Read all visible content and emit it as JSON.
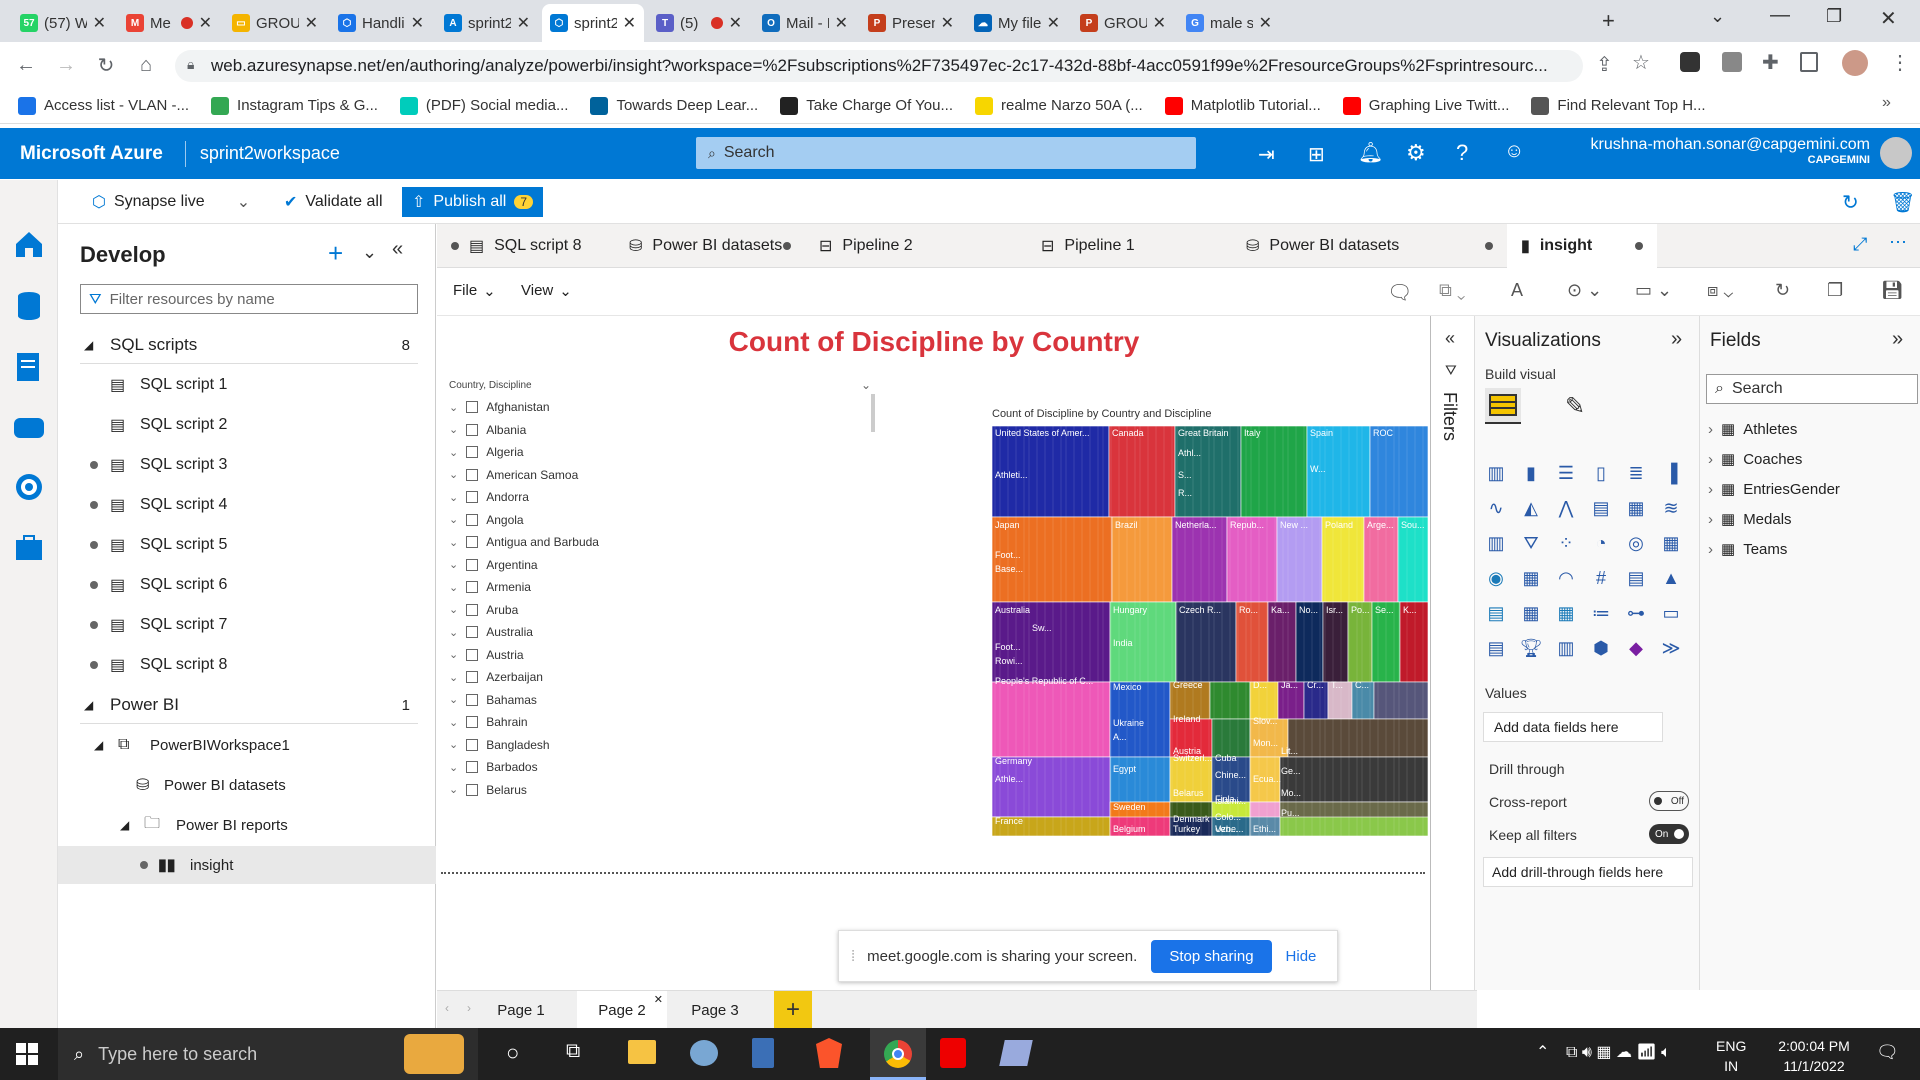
{
  "browser": {
    "tabs": [
      {
        "label": "(57) Wh",
        "color": "#25d366",
        "glyph": "57"
      },
      {
        "label": "Me",
        "color": "#ea4335",
        "glyph": "M",
        "recording": true
      },
      {
        "label": "GROUP",
        "color": "#f4b400",
        "glyph": "▭"
      },
      {
        "label": "Handlin",
        "color": "#1a73e8",
        "glyph": "⬡"
      },
      {
        "label": "sprint2",
        "color": "#0078d4",
        "glyph": "A"
      },
      {
        "label": "sprint2",
        "color": "#0078d4",
        "glyph": "⬡",
        "active": true
      },
      {
        "label": "(5)",
        "color": "#5b5fc7",
        "glyph": "T",
        "recording": true
      },
      {
        "label": "Mail - P",
        "color": "#0f6cbd",
        "glyph": "O"
      },
      {
        "label": "Present",
        "color": "#c43e1c",
        "glyph": "P"
      },
      {
        "label": "My files",
        "color": "#0364b8",
        "glyph": "☁"
      },
      {
        "label": "GROUP",
        "color": "#c43e1c",
        "glyph": "P"
      },
      {
        "label": "male sy",
        "color": "#4285f4",
        "glyph": "G"
      }
    ],
    "url": "web.azuresynapse.net/en/authoring/analyze/powerbi/insight?workspace=%2Fsubscriptions%2F735497ec-2c17-432d-88bf-4acc0591f99e%2FresourceGroups%2Fsprintresourc...",
    "bookmarks": [
      {
        "label": "Access list - VLAN -...",
        "color": "#1a73e8"
      },
      {
        "label": "Instagram Tips & G...",
        "color": "#34a853"
      },
      {
        "label": "(PDF) Social media...",
        "color": "#00ccbb"
      },
      {
        "label": "Towards Deep Lear...",
        "color": "#00629b"
      },
      {
        "label": "Take Charge Of You...",
        "color": "#222222"
      },
      {
        "label": "realme Narzo 50A (...",
        "color": "#f7d600"
      },
      {
        "label": "Matplotlib Tutorial...",
        "color": "#ff0000"
      },
      {
        "label": "Graphing Live Twitt...",
        "color": "#ff0000"
      },
      {
        "label": "Find Relevant Top H...",
        "color": "#555555"
      }
    ]
  },
  "azure": {
    "brand": "Microsoft Azure",
    "workspace": "sprint2workspace",
    "search_placeholder": "Search",
    "user_email": "krushna-mohan.sonar@capgemini.com",
    "user_org": "CAPGEMINI"
  },
  "toolbar": {
    "synapse_live": "Synapse live",
    "validate_all": "Validate all",
    "publish_all": "Publish all",
    "publish_count": "7"
  },
  "develop": {
    "title": "Develop",
    "filter_placeholder": "Filter resources by name",
    "sql_section": "SQL scripts",
    "sql_count": "8",
    "sql_scripts": [
      "SQL script 1",
      "SQL script 2",
      "SQL script 3",
      "SQL script 4",
      "SQL script 5",
      "SQL script 6",
      "SQL script 7",
      "SQL script 8"
    ],
    "powerbi_section": "Power BI",
    "powerbi_count": "1",
    "workspace_node": "PowerBIWorkspace1",
    "datasets_node": "Power BI datasets",
    "reports_node": "Power BI reports",
    "insight_node": "insight"
  },
  "doc_tabs": [
    "SQL script 8",
    "Power BI datasets",
    "Pipeline 2",
    "Pipeline 1",
    "Power BI datasets",
    "insight"
  ],
  "report": {
    "menu_file": "File",
    "menu_view": "View",
    "title": "Count of Discipline by Country",
    "slicer_header": "Country, Discipline",
    "slicer_items": [
      "Afghanistan",
      "Albania",
      "Algeria",
      "American Samoa",
      "Andorra",
      "Angola",
      "Antigua and Barbuda",
      "Argentina",
      "Armenia",
      "Aruba",
      "Australia",
      "Austria",
      "Azerbaijan",
      "Bahamas",
      "Bahrain",
      "Bangladesh",
      "Barbados",
      "Belarus"
    ],
    "treemap_title": "Count of Discipline by Country and Discipline",
    "treemap_labels": [
      "United States of Amer...",
      "Athleti...",
      "Canada",
      "Great Britain",
      "Athl...",
      "S...",
      "R...",
      "Italy",
      "Spain",
      "W...",
      "ROC",
      "Japan",
      "Foot...",
      "Base...",
      "Brazil",
      "Netherla...",
      "Repub...",
      "New ...",
      "Poland",
      "Arge...",
      "Sou...",
      "Australia",
      "Sw...",
      "Foot...",
      "Rowi...",
      "Hungary",
      "Czech R...",
      "Ro...",
      "Ka...",
      "No...",
      "Isr...",
      "Po...",
      "Se...",
      "K...",
      "India",
      "People's Republic of C...",
      "Mexico",
      "Greece",
      "D...",
      "Ja...",
      "Cr...",
      "T...",
      "C...",
      "Ireland",
      "Slov...",
      "Ukraine",
      "A...",
      "Austria",
      "Mon...",
      "Switzerl...",
      "Cuba",
      "Lit...",
      "Germany",
      "Athle...",
      "Egypt",
      "Belarus",
      "Chine...",
      "Ecua...",
      "Ge...",
      "Finla...",
      "Mo...",
      "Sweden",
      "Islami...",
      "Denmark",
      "Colo...",
      "Pu...",
      "Ven...",
      "France",
      "Belgium",
      "Turkey",
      "Uzbe...",
      "Ethi..."
    ],
    "colors": {
      "title": "#d9343c",
      "publish": "#0078d4"
    }
  },
  "panes": {
    "filters": "Filters",
    "visualizations": "Visualizations",
    "build_visual": "Build visual",
    "values": "Values",
    "add_data_fields": "Add data fields here",
    "drill_through": "Drill through",
    "cross_report": "Cross-report",
    "cross_report_state": "Off",
    "keep_filters": "Keep all filters",
    "keep_filters_state": "On",
    "add_drill_fields": "Add drill-through fields here",
    "fields": "Fields",
    "fields_search": "Search",
    "tables": [
      "Athletes",
      "Coaches",
      "EntriesGender",
      "Medals",
      "Teams"
    ]
  },
  "pages": [
    "Page 1",
    "Page 2",
    "Page 3"
  ],
  "share_bar": {
    "message": "meet.google.com is sharing your screen.",
    "stop": "Stop sharing",
    "hide": "Hide"
  },
  "taskbar": {
    "search_placeholder": "Type here to search",
    "lang": "ENG",
    "region": "IN",
    "time": "2:00:04 PM",
    "date": "11/1/2022"
  }
}
